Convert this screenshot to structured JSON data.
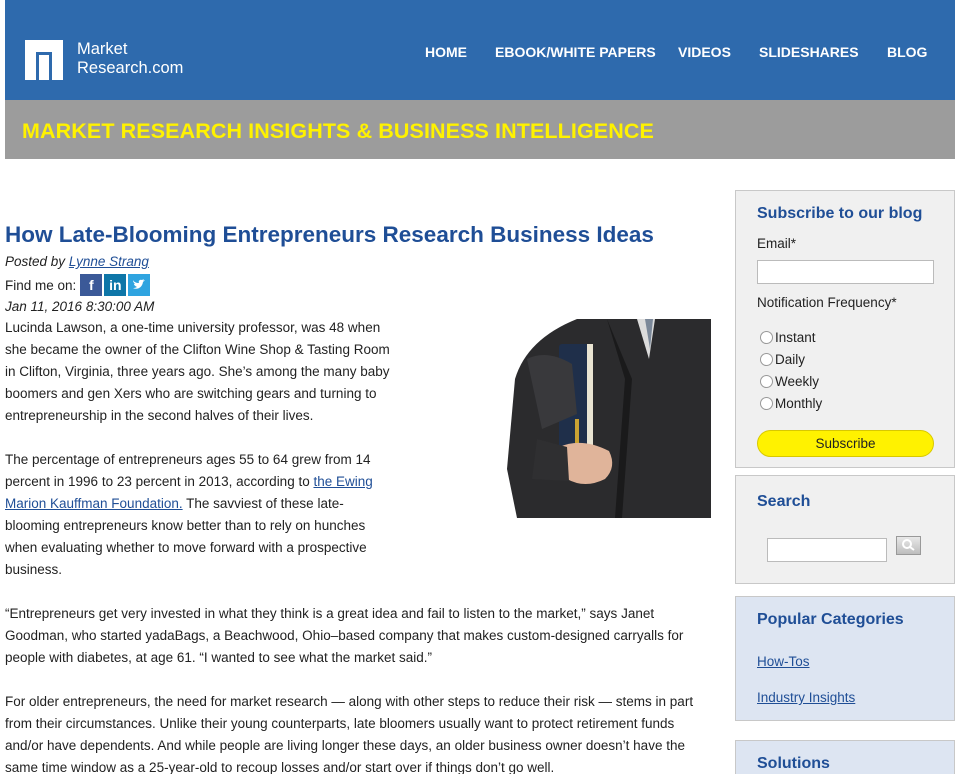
{
  "site": {
    "logo_line1": "Market",
    "logo_line2": "Research.com",
    "nav": [
      "HOME",
      "EBOOK/WHITE PAPERS",
      "VIDEOS",
      "SLIDESHARES",
      "BLOG"
    ],
    "banner": "MARKET RESEARCH INSIGHTS & BUSINESS INTELLIGENCE"
  },
  "article": {
    "title": "How Late-Blooming Entrepreneurs Research Business Ideas",
    "posted_by_label": "Posted by",
    "author": "Lynne Strang",
    "find_me_label": "Find me on:",
    "date": "Jan 11, 2016 8:30:00 AM",
    "p1": "Lucinda Lawson, a one-time university professor, was 48 when she became the owner of the Clifton Wine Shop & Tasting Room in Clifton, Virginia, three years ago. She’s among the many baby boomers and gen Xers who are switching gears and turning to entrepreneurship in the second halves of their lives.",
    "p2_before": "The percentage of entrepreneurs ages 55 to 64 grew from 14 percent in 1996 to 23 percent in 2013, according to",
    "p2_link": "the Ewing Marion Kauffman Foundation.",
    "p2_after": "The savviest of these late-blooming entrepreneurs know better than to rely on hunches when evaluating whether to move forward with a prospective business.",
    "p3": "“Entrepreneurs get very invested in what they think is a great idea and fail to listen to the market,” says Janet Goodman, who started yadaBags, a Beachwood, Ohio–based company that makes custom-designed carryalls for people with diabetes, at age 61. “I wanted to see what the market said.”",
    "p4": "For older entrepreneurs, the need for market research — along with other steps to reduce their risk — stems in part from their circumstances. Unlike their young counterparts, late bloomers usually want to protect retirement funds and/or have dependents. And while people are living longer these days, an older business owner doesn’t have the same time window as a 25-year-old to recoup losses and/or start over if things don’t go well."
  },
  "sidebar": {
    "subscribe": {
      "title": "Subscribe to our blog",
      "email_label": "Email*",
      "freq_label": "Notification Frequency*",
      "options": [
        "Instant",
        "Daily",
        "Weekly",
        "Monthly"
      ],
      "button": "Subscribe"
    },
    "search": {
      "title": "Search"
    },
    "categories": {
      "title": "Popular Categories",
      "items": [
        "How-Tos",
        "Industry Insights"
      ]
    },
    "solutions": {
      "title": "Solutions"
    }
  },
  "colors": {
    "header": "#2e6aad",
    "banner": "#9c9c9c",
    "banner_text": "#fff200",
    "title": "#1f4e96"
  }
}
